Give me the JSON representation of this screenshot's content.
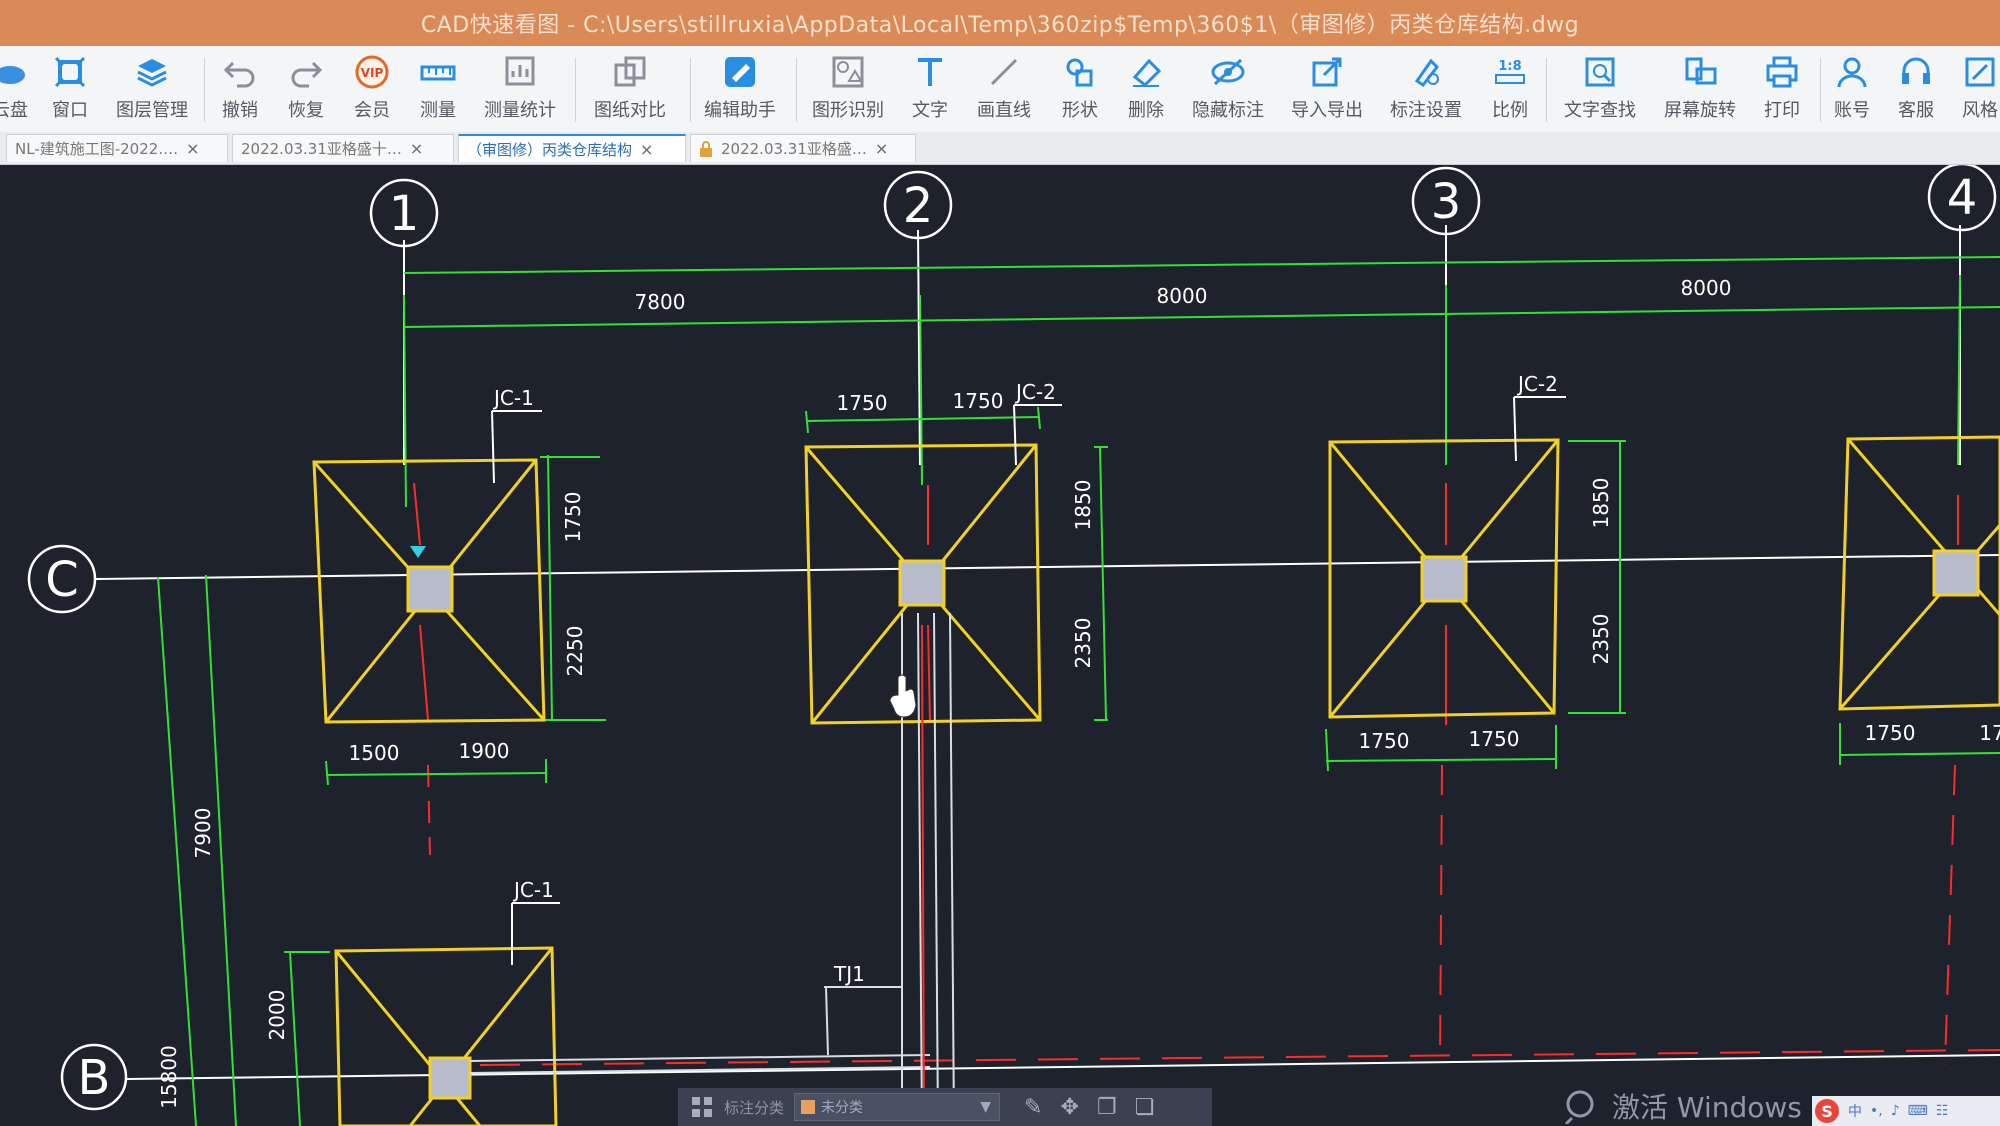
{
  "window": {
    "title": "CAD快速看图 - C:\\Users\\stillruxia\\AppData\\Local\\Temp\\360zip$Temp\\360$1\\（审图修）丙类仓库结构.dwg"
  },
  "toolbar": {
    "items": [
      {
        "id": "disk",
        "label": "云盘"
      },
      {
        "id": "window",
        "label": "窗口"
      },
      {
        "id": "layers",
        "label": "图层管理"
      },
      {
        "id": "undo",
        "label": "撤销"
      },
      {
        "id": "redo",
        "label": "恢复"
      },
      {
        "id": "vip",
        "label": "会员"
      },
      {
        "id": "measure",
        "label": "测量"
      },
      {
        "id": "measure-stats",
        "label": "测量统计"
      },
      {
        "id": "compare",
        "label": "图纸对比"
      },
      {
        "id": "edit-assist",
        "label": "编辑助手"
      },
      {
        "id": "shape-recog",
        "label": "图形识别"
      },
      {
        "id": "text",
        "label": "文字"
      },
      {
        "id": "line",
        "label": "画直线"
      },
      {
        "id": "shape",
        "label": "形状"
      },
      {
        "id": "delete",
        "label": "删除"
      },
      {
        "id": "hide-annot",
        "label": "隐藏标注"
      },
      {
        "id": "import-export",
        "label": "导入导出"
      },
      {
        "id": "annot-settings",
        "label": "标注设置"
      },
      {
        "id": "scale",
        "label": "比例"
      },
      {
        "id": "text-search",
        "label": "文字查找"
      },
      {
        "id": "rotate",
        "label": "屏幕旋转"
      },
      {
        "id": "print",
        "label": "打印"
      },
      {
        "id": "account",
        "label": "账号"
      },
      {
        "id": "service",
        "label": "客服"
      },
      {
        "id": "style",
        "label": "风格"
      }
    ]
  },
  "tabs": [
    {
      "label": "NL-建筑施工图-2022.…",
      "close": "×"
    },
    {
      "label": "2022.03.31亚格盛十…",
      "close": "×"
    },
    {
      "label": "（审图修）丙类仓库结构",
      "close": "×",
      "active": true
    },
    {
      "label": "2022.03.31亚格盛…",
      "close": "×"
    }
  ],
  "drawing": {
    "grid_cols": [
      "1",
      "2",
      "3",
      "4"
    ],
    "grid_rows": [
      "C",
      "B"
    ],
    "dims_top": [
      "7800",
      "8000",
      "8000"
    ],
    "col2_top_dims": [
      "1750",
      "1750"
    ],
    "footing_labels": [
      "JC-1",
      "JC-2",
      "JC-2",
      "JC-1"
    ],
    "f1_dims": {
      "v1": "1750",
      "v2": "2250",
      "h1": "1500",
      "h2": "1900"
    },
    "f2_dims": {
      "v1": "1850",
      "v2": "2350"
    },
    "f3_dims": {
      "v1": "1850",
      "v2": "2350",
      "h1": "1750",
      "h2": "1750"
    },
    "f4_dims": {
      "h1": "1750",
      "h2": "17"
    },
    "left_dims": {
      "a": "7900",
      "b": "15800",
      "c": "2000"
    },
    "beam_label": "TJ1",
    "colors": {
      "bg": "#1d222c",
      "grid": "#ffffff",
      "dim": "#33e033",
      "footing": "#f2d024",
      "axis": "#ff2a2a",
      "column": "#b7bccb",
      "text": "#ffffff"
    }
  },
  "bottombar": {
    "label": "标注分类",
    "selected": "未分类"
  },
  "system": {
    "activate_text": "激活 Windows",
    "tray": [
      "中",
      "•,",
      "♪",
      "⌨",
      "☷"
    ]
  }
}
